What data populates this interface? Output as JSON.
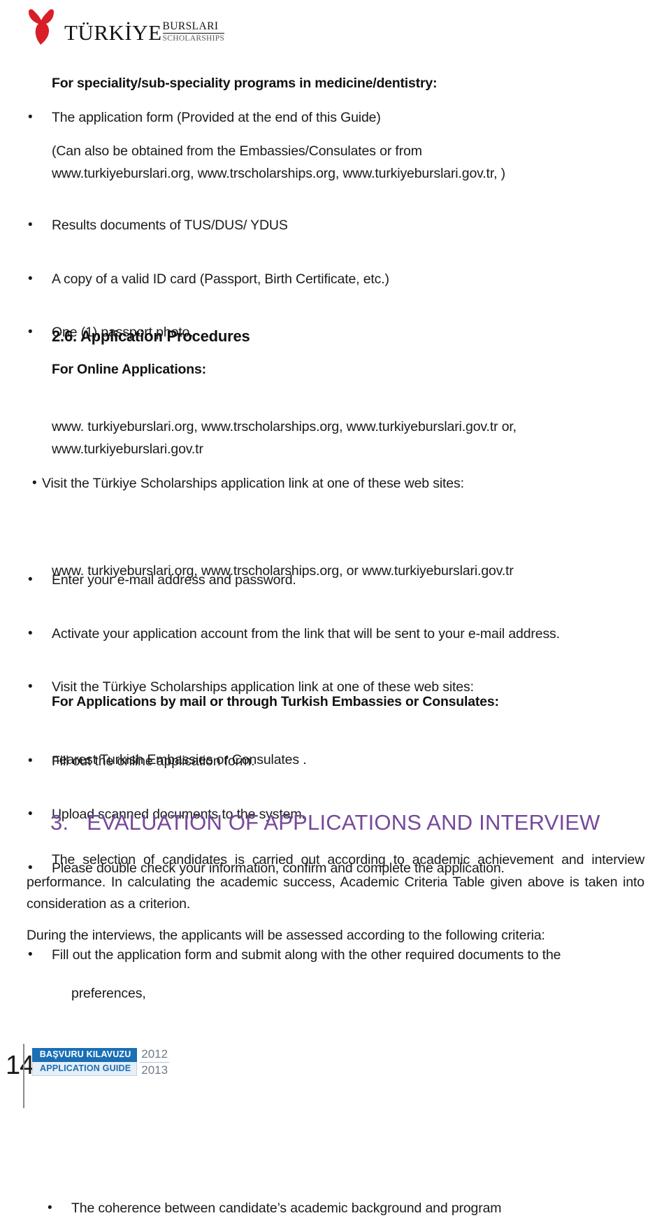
{
  "logo": {
    "mark": "tulip-icon",
    "word_main": "TÜRKİYE",
    "word_top": "BURSLARI",
    "word_bottom": "SCHOLARSHIPS",
    "red": "#d81e26"
  },
  "section_medicine": {
    "heading": "For speciality/sub-speciality programs in medicine/dentistry:",
    "bullet1": "The application form (Provided at the end of this Guide)",
    "subline1": "(Can also be obtained from the Embassies/Consulates or from",
    "subline2": "www.turkiyeburslari.org, www.trscholarships.org, www.turkiyeburslari.gov.tr, )",
    "bullet2": "Results documents of TUS/DUS/ YDUS",
    "bullet3": "A copy of a valid ID card (Passport, Birth Certificate, etc.)",
    "bullet4": "One (1) passport photo."
  },
  "section_26": {
    "heading": "2.6. Application Procedures",
    "subheading_online": "For Online Applications:",
    "b1_line1": "Visit the Türkiye Scholarships application link at one of these web sites:",
    "b1_line2": "www. turkiyeburslari.org, www.trscholarships.org, www.turkiyeburslari.gov.tr or,",
    "b1_line3": "www.turkiyeburslari.gov.tr",
    "b2": "Enter your e-mail address and password.",
    "b3": "Activate your application account from the link that will be sent to your e-mail address.",
    "b4_line1": "Visit the Türkiye Scholarships application link at one of these web sites:",
    "b4_line2": "www. turkiyeburslari.org, www.trscholarships.org, or www.turkiyeburslari.gov.tr",
    "b5": "Fill out the online application form.",
    "b6": "Upload scanned documents to the system.",
    "b7": "Please double check your information, confirm and complete the application.",
    "subheading_mail": "For Applications by mail or through Turkish  Embassies or Consulates:",
    "b8_line1": "Fill out the application form and submit along with the other required documents to the",
    "b8_line2": "nearest Turkish  Embassies or Consulates ."
  },
  "section_3": {
    "number": "3.",
    "title": "EVALUATION OF APPLICATIONS AND INTERVIEW",
    "color": "#76499a",
    "para1": "The selection of candidates is carried out according to academic achievement and interview performance. In calculating the academic success, Academic Criteria Table given above is taken into consideration as a criterion.",
    "para2": "During the interviews, the applicants will be assessed according to the following criteria:",
    "bullet1_line1": "The   coherence   between   candidate’s   academic   background   and   program",
    "bullet1_line2": "preferences,"
  },
  "footer": {
    "page_number": "14",
    "badge_tr": "BAŞVURU KILAVUZU",
    "badge_en": "APPLICATION GUIDE",
    "year_top": "2012",
    "year_bottom": "2013",
    "accent_blue": "#1a6fb5"
  },
  "bullet_glyph": "•"
}
